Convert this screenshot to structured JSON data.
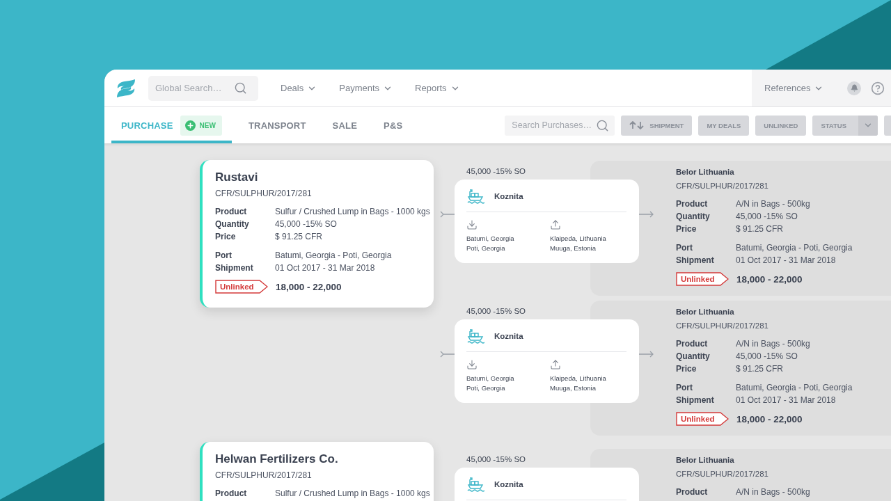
{
  "topbar": {
    "search_placeholder": "Global Search…",
    "nav": [
      {
        "label": "Deals"
      },
      {
        "label": "Payments"
      },
      {
        "label": "Reports"
      }
    ],
    "references": "References"
  },
  "tabs": [
    {
      "label": "PURCHASE",
      "selected": true,
      "new_button": "NEW"
    },
    {
      "label": "TRANSPORT",
      "selected": false
    },
    {
      "label": "SALE",
      "selected": false
    },
    {
      "label": "P&S",
      "selected": false
    }
  ],
  "toolbar": {
    "search_placeholder": "Search Purchases…",
    "buttons": [
      {
        "kind": "sort",
        "label": "SHIPMENT"
      },
      {
        "kind": "plain",
        "label": "MY DEALS"
      },
      {
        "kind": "plain",
        "label": "UNLINKED"
      },
      {
        "kind": "dropdown",
        "label": "STATUS"
      },
      {
        "kind": "blank"
      }
    ]
  },
  "groups": [
    {
      "purchase": {
        "company": "Rustavi",
        "reference": "CFR/SULPHUR/2017/281",
        "field_groups": [
          [
            {
              "label": "Product",
              "value": "Sulfur / Crushed Lump in Bags - 1000 kgs"
            },
            {
              "label": "Quantity",
              "value": "45,000 -15% SO"
            },
            {
              "label": "Price",
              "value": "$ 91.25 CFR"
            }
          ],
          [
            {
              "label": "Port",
              "value": "Batumi, Georgia - Poti, Georgia"
            },
            {
              "label": "Shipment",
              "value": "01 Oct 2017 - 31 Mar 2018"
            }
          ]
        ],
        "status": "Unlinked",
        "range": "18,000 - 22,000"
      },
      "links": [
        {
          "quantity": "45,000 -15% SO",
          "transport": {
            "vessel": "Koznita",
            "load": [
              "Batumi, Georgia",
              "Poti, Georgia"
            ],
            "discharge": [
              "Klaipeda, Lithuania",
              "Muuga, Estonia"
            ]
          },
          "sale": {
            "company": "Belor Lithuania",
            "reference": "CFR/SULPHUR/2017/281",
            "field_groups": [
              [
                {
                  "label": "Product",
                  "value": "A/N in Bags - 500kg"
                },
                {
                  "label": "Quantity",
                  "value": "45,000 -15% SO"
                },
                {
                  "label": "Price",
                  "value": "$ 91.25 CFR"
                }
              ],
              [
                {
                  "label": "Port",
                  "value": "Batumi, Georgia - Poti, Georgia"
                },
                {
                  "label": "Shipment",
                  "value": "01 Oct 2017 - 31 Mar 2018"
                }
              ]
            ],
            "status": "Unlinked",
            "range": "18,000 - 22,000"
          }
        },
        {
          "quantity": "45,000 -15% SO",
          "transport": {
            "vessel": "Koznita",
            "load": [
              "Batumi, Georgia",
              "Poti, Georgia"
            ],
            "discharge": [
              "Klaipeda, Lithuania",
              "Muuga, Estonia"
            ]
          },
          "sale": {
            "company": "Belor Lithuania",
            "reference": "CFR/SULPHUR/2017/281",
            "field_groups": [
              [
                {
                  "label": "Product",
                  "value": "A/N in Bags - 500kg"
                },
                {
                  "label": "Quantity",
                  "value": "45,000 -15% SO"
                },
                {
                  "label": "Price",
                  "value": "$ 91.25 CFR"
                }
              ],
              [
                {
                  "label": "Port",
                  "value": "Batumi, Georgia - Poti, Georgia"
                },
                {
                  "label": "Shipment",
                  "value": "01 Oct 2017 - 31 Mar 2018"
                }
              ]
            ],
            "status": "Unlinked",
            "range": "18,000 - 22,000"
          }
        }
      ]
    },
    {
      "purchase": {
        "company": "Helwan Fertilizers Co.",
        "reference": "CFR/SULPHUR/2017/281",
        "field_groups": [
          [
            {
              "label": "Product",
              "value": "Sulfur / Crushed Lump in Bags - 1000 kgs"
            }
          ]
        ]
      },
      "links": [
        {
          "quantity": "45,000 -15% SO",
          "transport": {
            "vessel": "Koznita"
          },
          "sale": {
            "company": "Belor Lithuania",
            "reference": "CFR/SULPHUR/2017/281",
            "field_groups": [
              [
                {
                  "label": "Product",
                  "value": "A/N in Bags - 500kg"
                }
              ]
            ]
          }
        }
      ]
    }
  ]
}
